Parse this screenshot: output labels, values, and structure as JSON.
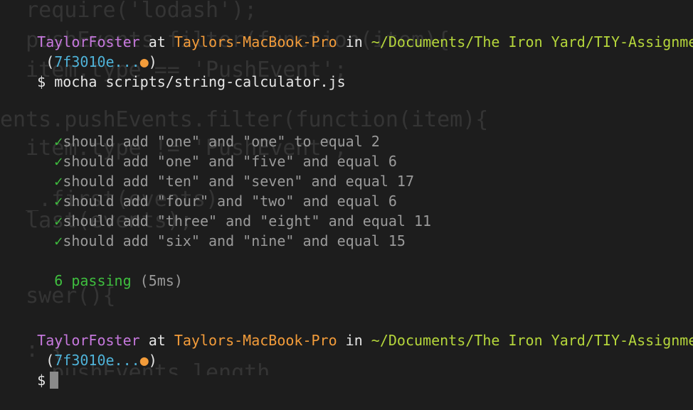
{
  "background_code": [
    "  require('lodash');",
    "  pushEvents.filter(function(item){",
    "  item.type == 'PushEvent';",
    "",
    "ents.pushEvents.filter(function(item){",
    "  item.type != 'PushEvent';",
    "",
    "  _.first(events)",
    "  last(events);",
    "",
    "  swer(){",
    "",
    "",
    "  : {",
    "    pushEvents.length"
  ],
  "prompt1": {
    "user": "TaylorFoster",
    "at": " at ",
    "host": "Taylors-MacBook-Pro",
    "in": " in ",
    "path": "~/Documents/The Iron Yard/TIY-Assignments",
    "open_paren": " (",
    "hash": "7f3010e...",
    "dot": "●",
    "close_paren": ")"
  },
  "command_line": {
    "prompt_symbol": "$",
    "command": " mocha scripts/string-calculator.js"
  },
  "tests": [
    {
      "check": "✓",
      "text": "should add \"one\" and \"one\" to equal 2"
    },
    {
      "check": "✓",
      "text": "should add \"one\" and \"five\" and equal 6"
    },
    {
      "check": "✓",
      "text": "should add \"ten\" and \"seven\" and equal 17"
    },
    {
      "check": "✓",
      "text": "should add \"four\" and \"two\" and equal 6"
    },
    {
      "check": "✓",
      "text": "should add \"three\" and \"eight\" and equal 11"
    },
    {
      "check": "✓",
      "text": "should add \"six\" and \"nine\" and equal 15"
    }
  ],
  "summary": {
    "passing": "6 passing",
    "duration": " (5ms)"
  },
  "prompt2": {
    "user": "TaylorFoster",
    "at": " at ",
    "host": "Taylors-MacBook-Pro",
    "in": " in ",
    "path": "~/Documents/The Iron Yard/TIY-Assignments",
    "open_paren": " (",
    "hash": "7f3010e...",
    "dot": "●",
    "close_paren": ")"
  },
  "final_prompt": {
    "prompt_symbol": "$"
  },
  "colors": {
    "background": "#1d1d1d",
    "user": "#c678dd",
    "host": "#f39c3a",
    "path": "#b5d63b",
    "hash": "#4fb3d9",
    "pass": "#3fbf3f",
    "dim": "#9a9a9a"
  }
}
